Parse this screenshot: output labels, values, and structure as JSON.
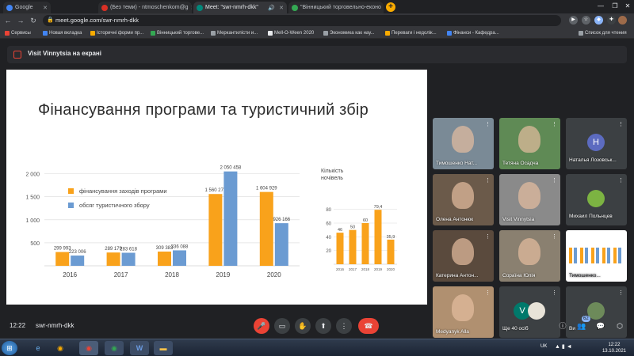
{
  "browser": {
    "tabs": [
      {
        "label": "Google",
        "color": "#4285f4"
      },
      {
        "label": "(Без теми) - ntmoschenkom@g",
        "color": "#d93025"
      },
      {
        "label": "Meet: \"swr-nmrh-dkk\"",
        "color": "#00897b"
      },
      {
        "label": "\"Вінницький торговельно-еконо",
        "color": "#34a853"
      }
    ],
    "url": "meet.google.com/swr-nmrh-dkk",
    "bookmarks": [
      {
        "label": "Сервисы",
        "color": "#ea4335"
      },
      {
        "label": "Новая вкладка",
        "color": "#4285f4"
      },
      {
        "label": "Історичні форми пр...",
        "color": "#f9ab00"
      },
      {
        "label": "Вінницький торгове...",
        "color": "#34a853"
      },
      {
        "label": "Меркантилісти и...",
        "color": "#9aa0a6"
      },
      {
        "label": "Mell-O-Ween 2020",
        "color": "#e8eaed"
      },
      {
        "label": "Экономика как нау...",
        "color": "#9aa0a6"
      },
      {
        "label": "Переваги і недолік...",
        "color": "#f9ab00"
      },
      {
        "label": "Фінанси - Кафедра...",
        "color": "#4285f4"
      }
    ],
    "reading_list": "Список для чтения"
  },
  "meet": {
    "presenter_banner": "Visit Vinnytsia на екрані",
    "time": "12:22",
    "code": "swr-nmrh-dkk",
    "people_count": "62",
    "participants": [
      {
        "name": "Тимошенко Нат...",
        "kind": "video",
        "bg": "#7a8a96"
      },
      {
        "name": "Тетяна Осадча",
        "kind": "video",
        "bg": "#5f8a55"
      },
      {
        "name": "Наталья Лозовськ...",
        "kind": "avatar",
        "bg": "#3c4043",
        "letter": "H",
        "avatar_color": "#5c6bc0"
      },
      {
        "name": "Олена Антонюк",
        "kind": "video",
        "bg": "#6b5a4a"
      },
      {
        "name": "Visit Vinnytsia",
        "kind": "video",
        "bg": "#8a8a8a"
      },
      {
        "name": "Михаил Польнцев",
        "kind": "avatar",
        "bg": "#3c4043",
        "letter": "",
        "avatar_color": "#7cb342"
      },
      {
        "name": "Катерина Антон...",
        "kind": "video",
        "bg": "#5a4a3d"
      },
      {
        "name": "Сораїна Юлія",
        "kind": "video",
        "bg": "#8a8070"
      },
      {
        "name": "Тимошенко...",
        "kind": "screen",
        "bg": "#ffffff"
      },
      {
        "name": "Medyanyk Alla",
        "kind": "video",
        "bg": "#b09070"
      },
      {
        "name": "Ще 40 осіб",
        "kind": "more",
        "bg": "#3c4043",
        "letter": "V",
        "avatar_color": "#00796b"
      },
      {
        "name": "Ви",
        "kind": "avatar",
        "bg": "#3c4043",
        "letter": "",
        "avatar_color": "#6d8a5a"
      }
    ]
  },
  "slide": {
    "title": "Фінансування програми та туристичний збір",
    "legend": [
      "фінансування заходів програми",
      "обсяг туристичного збору"
    ]
  },
  "chart_data": [
    {
      "type": "bar",
      "categories": [
        "2016",
        "2017",
        "2018",
        "2019",
        "2020"
      ],
      "series": [
        {
          "name": "фінансування заходів програми",
          "color": "#f9a21b",
          "values": [
            299993,
            289179,
            309383,
            1560277,
            1604929
          ]
        },
        {
          "name": "обсяг туристичного збору",
          "color": "#6b9bd2",
          "values": [
            223006,
            283618,
            336088,
            2050458,
            926166
          ]
        }
      ],
      "data_labels": [
        [
          "299 993",
          "289 179",
          "309 383",
          "1 560 277",
          "1 604 929"
        ],
        [
          "223 006",
          "283 618",
          "336 088",
          "2 050 458",
          "926 166"
        ]
      ],
      "yticks": [
        "500",
        "1 000",
        "1 500",
        "2 000"
      ],
      "ylim": [
        0,
        2200000
      ],
      "grid": true
    },
    {
      "type": "bar",
      "title": "Кількість ночівель",
      "categories": [
        "2016",
        "2017",
        "2018",
        "2019",
        "2020"
      ],
      "values": [
        46,
        50,
        60,
        79.4,
        35.9
      ],
      "data_labels": [
        "46",
        "50",
        "60",
        "79,4",
        "35,9"
      ],
      "yticks": [
        "20",
        "40",
        "60",
        "80"
      ],
      "ylim": [
        0,
        90
      ],
      "color": "#f9a21b"
    }
  ],
  "taskbar": {
    "lang": "UK",
    "clock_time": "12:22",
    "clock_date": "13.10.2021"
  }
}
